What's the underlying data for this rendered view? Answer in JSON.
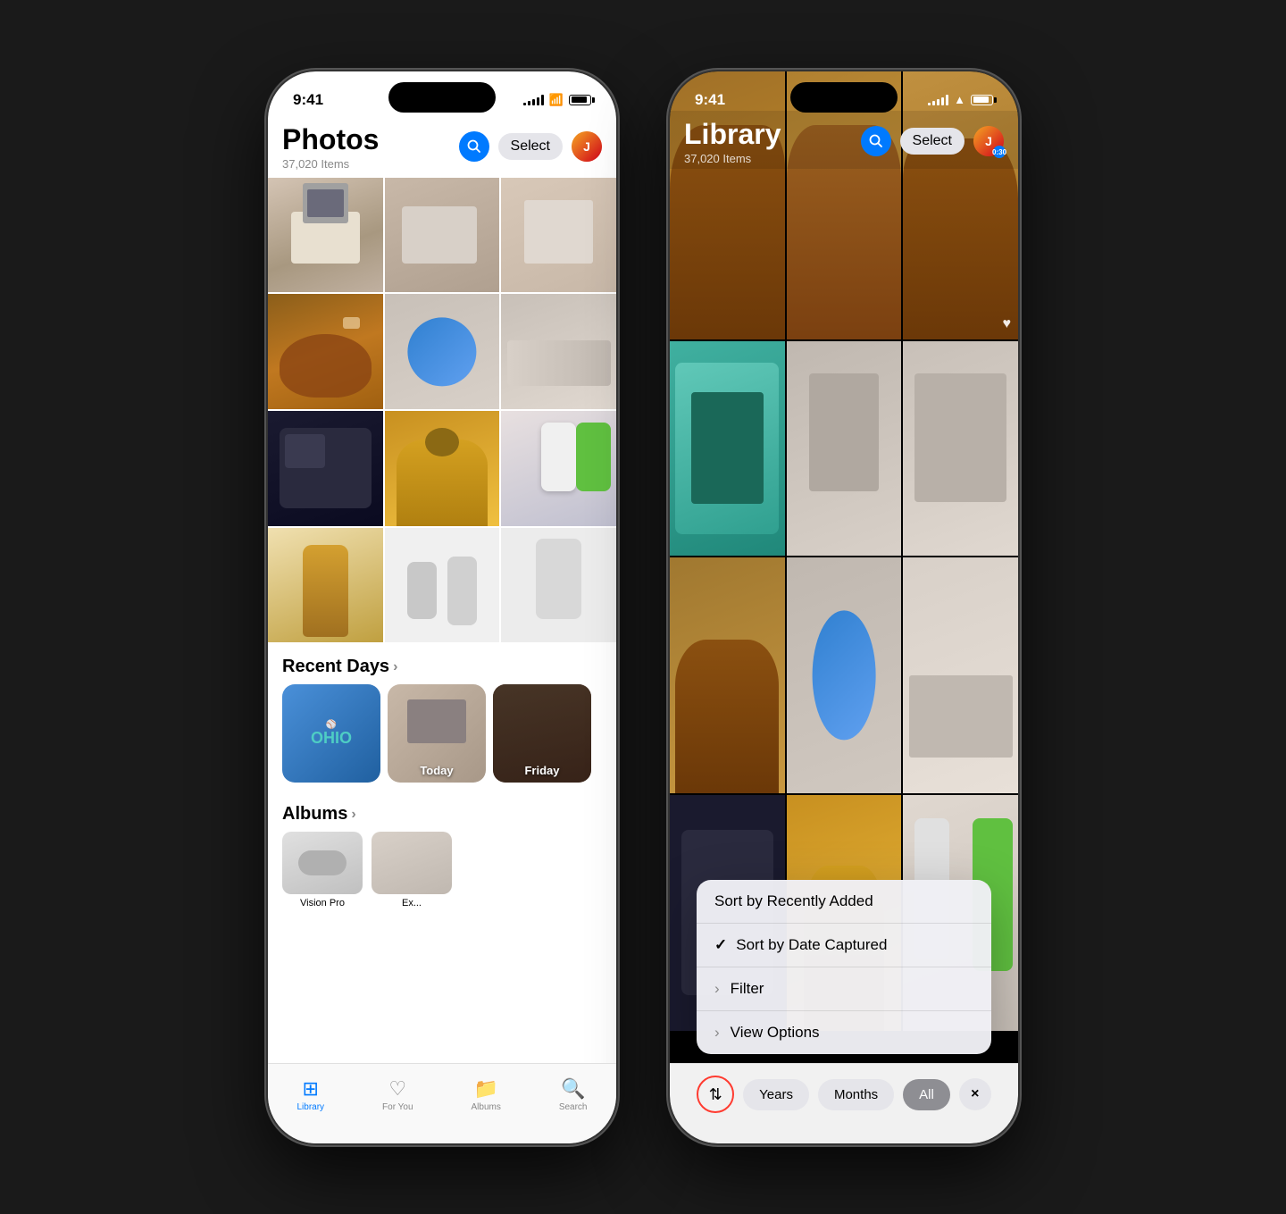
{
  "phone1": {
    "status": {
      "time": "9:41",
      "signal": [
        3,
        5,
        7,
        9,
        11
      ],
      "battery": 85
    },
    "header": {
      "title": "Photos",
      "itemCount": "37,020 Items",
      "selectLabel": "Select"
    },
    "grid": {
      "photos": [
        {
          "color": "img-computer",
          "id": "p1"
        },
        {
          "color": "img-computer",
          "id": "p2"
        },
        {
          "color": "img-computer",
          "id": "p3"
        },
        {
          "color": "img-dog-brown",
          "id": "p4"
        },
        {
          "color": "img-blue-ball",
          "id": "p5"
        },
        {
          "color": "img-keyboard",
          "id": "p6"
        },
        {
          "color": "img-ds",
          "id": "p7"
        },
        {
          "color": "img-golden",
          "id": "p8"
        },
        {
          "color": "img-ipod",
          "id": "p9"
        },
        {
          "color": "img-dalek",
          "id": "p10"
        },
        {
          "color": "img-remote",
          "id": "p11"
        },
        {
          "color": "img-ipod",
          "id": "p12"
        }
      ]
    },
    "recentDays": {
      "sectionLabel": "Recent Days",
      "chevron": ">",
      "days": [
        {
          "label": "",
          "color": "img-ohio"
        },
        {
          "label": "Today",
          "color": "img-computer"
        },
        {
          "label": "Friday",
          "color": "img-room"
        }
      ]
    },
    "albums": {
      "sectionLabel": "Albums",
      "chevron": ">",
      "items": [
        {
          "label": "Vision Pro",
          "color": "img-remote"
        },
        {
          "label": "Ex...",
          "color": "img-keyboard"
        }
      ]
    }
  },
  "phone2": {
    "status": {
      "time": "9:41",
      "videoBadge": "0:30"
    },
    "header": {
      "title": "Library",
      "itemCount": "37,020 Items",
      "selectLabel": "Select"
    },
    "contextMenu": {
      "items": [
        {
          "label": "Sort by Recently Added",
          "type": "normal",
          "prefix": ""
        },
        {
          "label": "Sort by Date Captured",
          "type": "checked",
          "prefix": "✓"
        },
        {
          "label": "Filter",
          "type": "submenu",
          "prefix": ">"
        },
        {
          "label": "View Options",
          "type": "submenu",
          "prefix": ">"
        }
      ]
    },
    "sortBar": {
      "sortIconLabel": "⇅",
      "yearsLabel": "Years",
      "monthsLabel": "Months",
      "allLabel": "All",
      "closeLabel": "×"
    }
  }
}
